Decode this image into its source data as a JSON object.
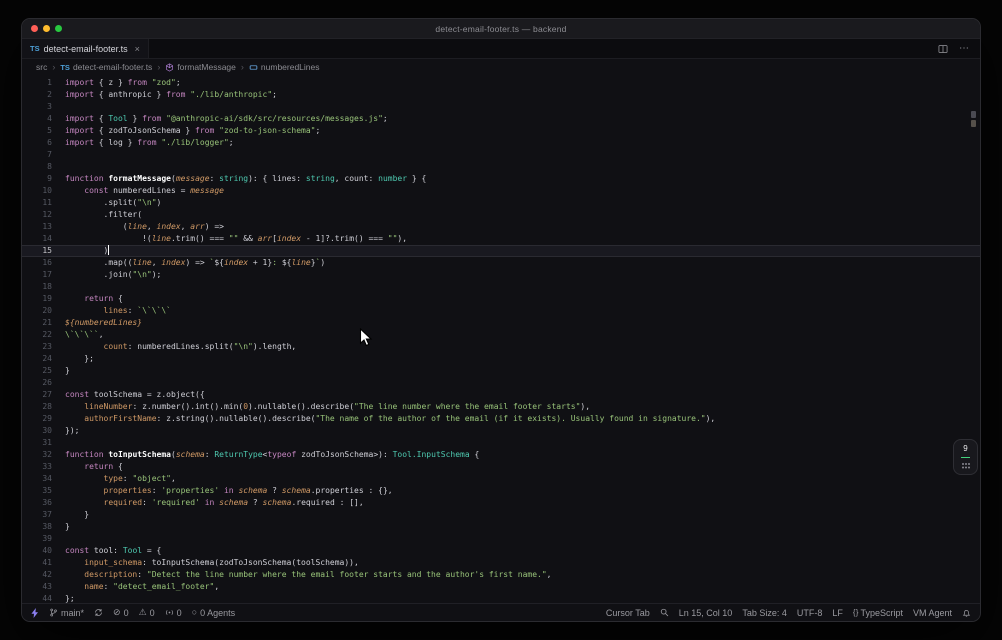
{
  "window": {
    "title": "detect-email-footer.ts — backend"
  },
  "tab_bar": {
    "tabs": [
      {
        "icon": "TS",
        "label": "detect-email-footer.ts",
        "close_label": "×",
        "active": true
      }
    ]
  },
  "breadcrumb": {
    "separator": "›",
    "items": [
      {
        "label": "src"
      },
      {
        "icon": "TS",
        "label": "detect-email-footer.ts"
      },
      {
        "icon": "method",
        "label": "formatMessage"
      },
      {
        "icon": "variable",
        "label": "numberedLines"
      }
    ]
  },
  "side_widget": {
    "badge": "9"
  },
  "editor": {
    "active_line": 15,
    "cursor": {
      "line": 15,
      "col": 10
    },
    "lines": [
      [
        [
          "k",
          "import "
        ],
        [
          "p",
          "{ z } "
        ],
        [
          "k",
          "from "
        ],
        [
          "s",
          "\"zod\""
        ],
        [
          "p",
          ";"
        ]
      ],
      [
        [
          "k",
          "import "
        ],
        [
          "p",
          "{ anthropic } "
        ],
        [
          "k",
          "from "
        ],
        [
          "s",
          "\"./lib/anthropic\""
        ],
        [
          "p",
          ";"
        ]
      ],
      [],
      [
        [
          "k",
          "import "
        ],
        [
          "p",
          "{ "
        ],
        [
          "t",
          "Tool"
        ],
        [
          "p",
          " } "
        ],
        [
          "k",
          "from "
        ],
        [
          "s",
          "\"@anthropic-ai/sdk/src/resources/messages.js\""
        ],
        [
          "p",
          ";"
        ]
      ],
      [
        [
          "k",
          "import "
        ],
        [
          "p",
          "{ zodToJsonSchema } "
        ],
        [
          "k",
          "from "
        ],
        [
          "s",
          "\"zod-to-json-schema\""
        ],
        [
          "p",
          ";"
        ]
      ],
      [
        [
          "k",
          "import "
        ],
        [
          "p",
          "{ log } "
        ],
        [
          "k",
          "from "
        ],
        [
          "s",
          "\"./lib/logger\""
        ],
        [
          "p",
          ";"
        ]
      ],
      [],
      [],
      [
        [
          "k",
          "function "
        ],
        [
          "f",
          "formatMessage"
        ],
        [
          "p",
          "("
        ],
        [
          "i",
          "message"
        ],
        [
          "p",
          ": "
        ],
        [
          "t",
          "string"
        ],
        [
          "p",
          "): { lines: "
        ],
        [
          "t",
          "string"
        ],
        [
          "p",
          ", count: "
        ],
        [
          "t",
          "number"
        ],
        [
          "p",
          " } {"
        ]
      ],
      [
        [
          "p",
          "    "
        ],
        [
          "k",
          "const "
        ],
        [
          "p",
          "numberedLines = "
        ],
        [
          "i",
          "message"
        ]
      ],
      [
        [
          "p",
          "        .split("
        ],
        [
          "s",
          "\"\\n\""
        ],
        [
          "p",
          ")"
        ]
      ],
      [
        [
          "p",
          "        .filter("
        ]
      ],
      [
        [
          "p",
          "            ("
        ],
        [
          "i",
          "line"
        ],
        [
          "p",
          ", "
        ],
        [
          "i",
          "index"
        ],
        [
          "p",
          ", "
        ],
        [
          "i",
          "arr"
        ],
        [
          "p",
          ") =>"
        ]
      ],
      [
        [
          "p",
          "                !("
        ],
        [
          "i",
          "line"
        ],
        [
          "p",
          ".trim() === "
        ],
        [
          "s",
          "\"\""
        ],
        [
          "p",
          " && "
        ],
        [
          "i",
          "arr"
        ],
        [
          "p",
          "["
        ],
        [
          "i",
          "index"
        ],
        [
          "p",
          " - 1]?.trim() === "
        ],
        [
          "s",
          "\"\""
        ],
        [
          "p",
          "),"
        ]
      ],
      [
        [
          "p",
          "        )"
        ]
      ],
      [
        [
          "p",
          "        .map(("
        ],
        [
          "i",
          "line"
        ],
        [
          "p",
          ", "
        ],
        [
          "i",
          "index"
        ],
        [
          "p",
          ") => "
        ],
        [
          "s",
          "`"
        ],
        [
          "p",
          "${"
        ],
        [
          "i",
          "index"
        ],
        [
          "p",
          " + 1}"
        ],
        [
          "s",
          ": "
        ],
        [
          "p",
          "${"
        ],
        [
          "i",
          "line"
        ],
        [
          "p",
          "}"
        ],
        [
          "s",
          "`"
        ],
        [
          "p",
          ")"
        ]
      ],
      [
        [
          "p",
          "        .join("
        ],
        [
          "s",
          "\"\\n\""
        ],
        [
          "p",
          ");"
        ]
      ],
      [],
      [
        [
          "p",
          "    "
        ],
        [
          "k",
          "return"
        ],
        [
          "p",
          " {"
        ]
      ],
      [
        [
          "p",
          "        "
        ],
        [
          "w",
          "lines"
        ],
        [
          "p",
          ": "
        ],
        [
          "s",
          "`\\`\\`\\`"
        ]
      ],
      [
        [
          "i",
          "${numberedLines}"
        ]
      ],
      [
        [
          "s",
          "\\`\\`\\``"
        ],
        [
          "p",
          ","
        ]
      ],
      [
        [
          "p",
          "        "
        ],
        [
          "w",
          "count"
        ],
        [
          "p",
          ": numberedLines.split("
        ],
        [
          "s",
          "\"\\n\""
        ],
        [
          "p",
          ").length,"
        ]
      ],
      [
        [
          "p",
          "    };"
        ]
      ],
      [
        [
          "p",
          "}"
        ]
      ],
      [],
      [
        [
          "k",
          "const "
        ],
        [
          "p",
          "toolSchema = z.object({"
        ]
      ],
      [
        [
          "p",
          "    "
        ],
        [
          "w",
          "lineNumber"
        ],
        [
          "p",
          ": z.number().int().min("
        ],
        [
          "w",
          "0"
        ],
        [
          "p",
          ").nullable().describe("
        ],
        [
          "s",
          "\"The line number where the email footer starts\""
        ],
        [
          "p",
          "),"
        ]
      ],
      [
        [
          "p",
          "    "
        ],
        [
          "w",
          "authorFirstName"
        ],
        [
          "p",
          ": z.string().nullable().describe("
        ],
        [
          "s",
          "\"The name of the author of the email (if it exists). Usually found in signature.\""
        ],
        [
          "p",
          "),"
        ]
      ],
      [
        [
          "p",
          "});"
        ]
      ],
      [],
      [
        [
          "k",
          "function "
        ],
        [
          "f",
          "toInputSchema"
        ],
        [
          "p",
          "("
        ],
        [
          "i",
          "schema"
        ],
        [
          "p",
          ": "
        ],
        [
          "t",
          "ReturnType"
        ],
        [
          "p",
          "<"
        ],
        [
          "k",
          "typeof"
        ],
        [
          "p",
          " zodToJsonSchema>): "
        ],
        [
          "t",
          "Tool.InputSchema"
        ],
        [
          "p",
          " {"
        ]
      ],
      [
        [
          "p",
          "    "
        ],
        [
          "k",
          "return"
        ],
        [
          "p",
          " {"
        ]
      ],
      [
        [
          "p",
          "        "
        ],
        [
          "w",
          "type"
        ],
        [
          "p",
          ": "
        ],
        [
          "s",
          "\"object\""
        ],
        [
          "p",
          ","
        ]
      ],
      [
        [
          "p",
          "        "
        ],
        [
          "w",
          "properties"
        ],
        [
          "p",
          ": "
        ],
        [
          "s",
          "'properties'"
        ],
        [
          "p",
          " "
        ],
        [
          "k",
          "in"
        ],
        [
          "p",
          " "
        ],
        [
          "i",
          "schema"
        ],
        [
          "p",
          " ? "
        ],
        [
          "i",
          "schema"
        ],
        [
          "p",
          ".properties : {},"
        ]
      ],
      [
        [
          "p",
          "        "
        ],
        [
          "w",
          "required"
        ],
        [
          "p",
          ": "
        ],
        [
          "s",
          "'required'"
        ],
        [
          "p",
          " "
        ],
        [
          "k",
          "in"
        ],
        [
          "p",
          " "
        ],
        [
          "i",
          "schema"
        ],
        [
          "p",
          " ? "
        ],
        [
          "i",
          "schema"
        ],
        [
          "p",
          ".required : [],"
        ]
      ],
      [
        [
          "p",
          "    }"
        ]
      ],
      [
        [
          "p",
          "}"
        ]
      ],
      [],
      [
        [
          "k",
          "const "
        ],
        [
          "p",
          "tool: "
        ],
        [
          "t",
          "Tool"
        ],
        [
          "p",
          " = {"
        ]
      ],
      [
        [
          "p",
          "    "
        ],
        [
          "w",
          "input_schema"
        ],
        [
          "p",
          ": toInputSchema(zodToJsonSchema(toolSchema)),"
        ]
      ],
      [
        [
          "p",
          "    "
        ],
        [
          "w",
          "description"
        ],
        [
          "p",
          ": "
        ],
        [
          "s",
          "\"Detect the line number where the email footer starts and the author's first name.\""
        ],
        [
          "p",
          ","
        ]
      ],
      [
        [
          "p",
          "    "
        ],
        [
          "w",
          "name"
        ],
        [
          "p",
          ": "
        ],
        [
          "s",
          "\"detect_email_footer\""
        ],
        [
          "p",
          ","
        ]
      ],
      [
        [
          "p",
          "};"
        ]
      ]
    ]
  },
  "status_bar": {
    "left": [
      {
        "name": "remote",
        "icon": "bolt",
        "label": ""
      },
      {
        "name": "git-branch",
        "icon": "branch",
        "label": "main*"
      },
      {
        "name": "sync",
        "icon": "sync",
        "label": ""
      },
      {
        "name": "errors",
        "icon": "error",
        "label": "0"
      },
      {
        "name": "warnings",
        "icon": "warning",
        "label": "0"
      },
      {
        "name": "notifications-count",
        "icon": "radio",
        "label": "0"
      },
      {
        "name": "agents",
        "icon": "circle",
        "label": "0 Agents"
      }
    ],
    "right": [
      {
        "name": "cursor-tab",
        "label": "Cursor Tab"
      },
      {
        "name": "search",
        "icon": "search",
        "label": ""
      },
      {
        "name": "cursor-position",
        "label": "Ln 15, Col 10"
      },
      {
        "name": "tab-size",
        "label": "Tab Size: 4"
      },
      {
        "name": "encoding",
        "label": "UTF-8"
      },
      {
        "name": "eol",
        "label": "LF"
      },
      {
        "name": "language",
        "icon": "braces",
        "label": "TypeScript"
      },
      {
        "name": "vm-agent",
        "label": "VM Agent"
      },
      {
        "name": "bell",
        "icon": "bell",
        "label": ""
      }
    ]
  }
}
